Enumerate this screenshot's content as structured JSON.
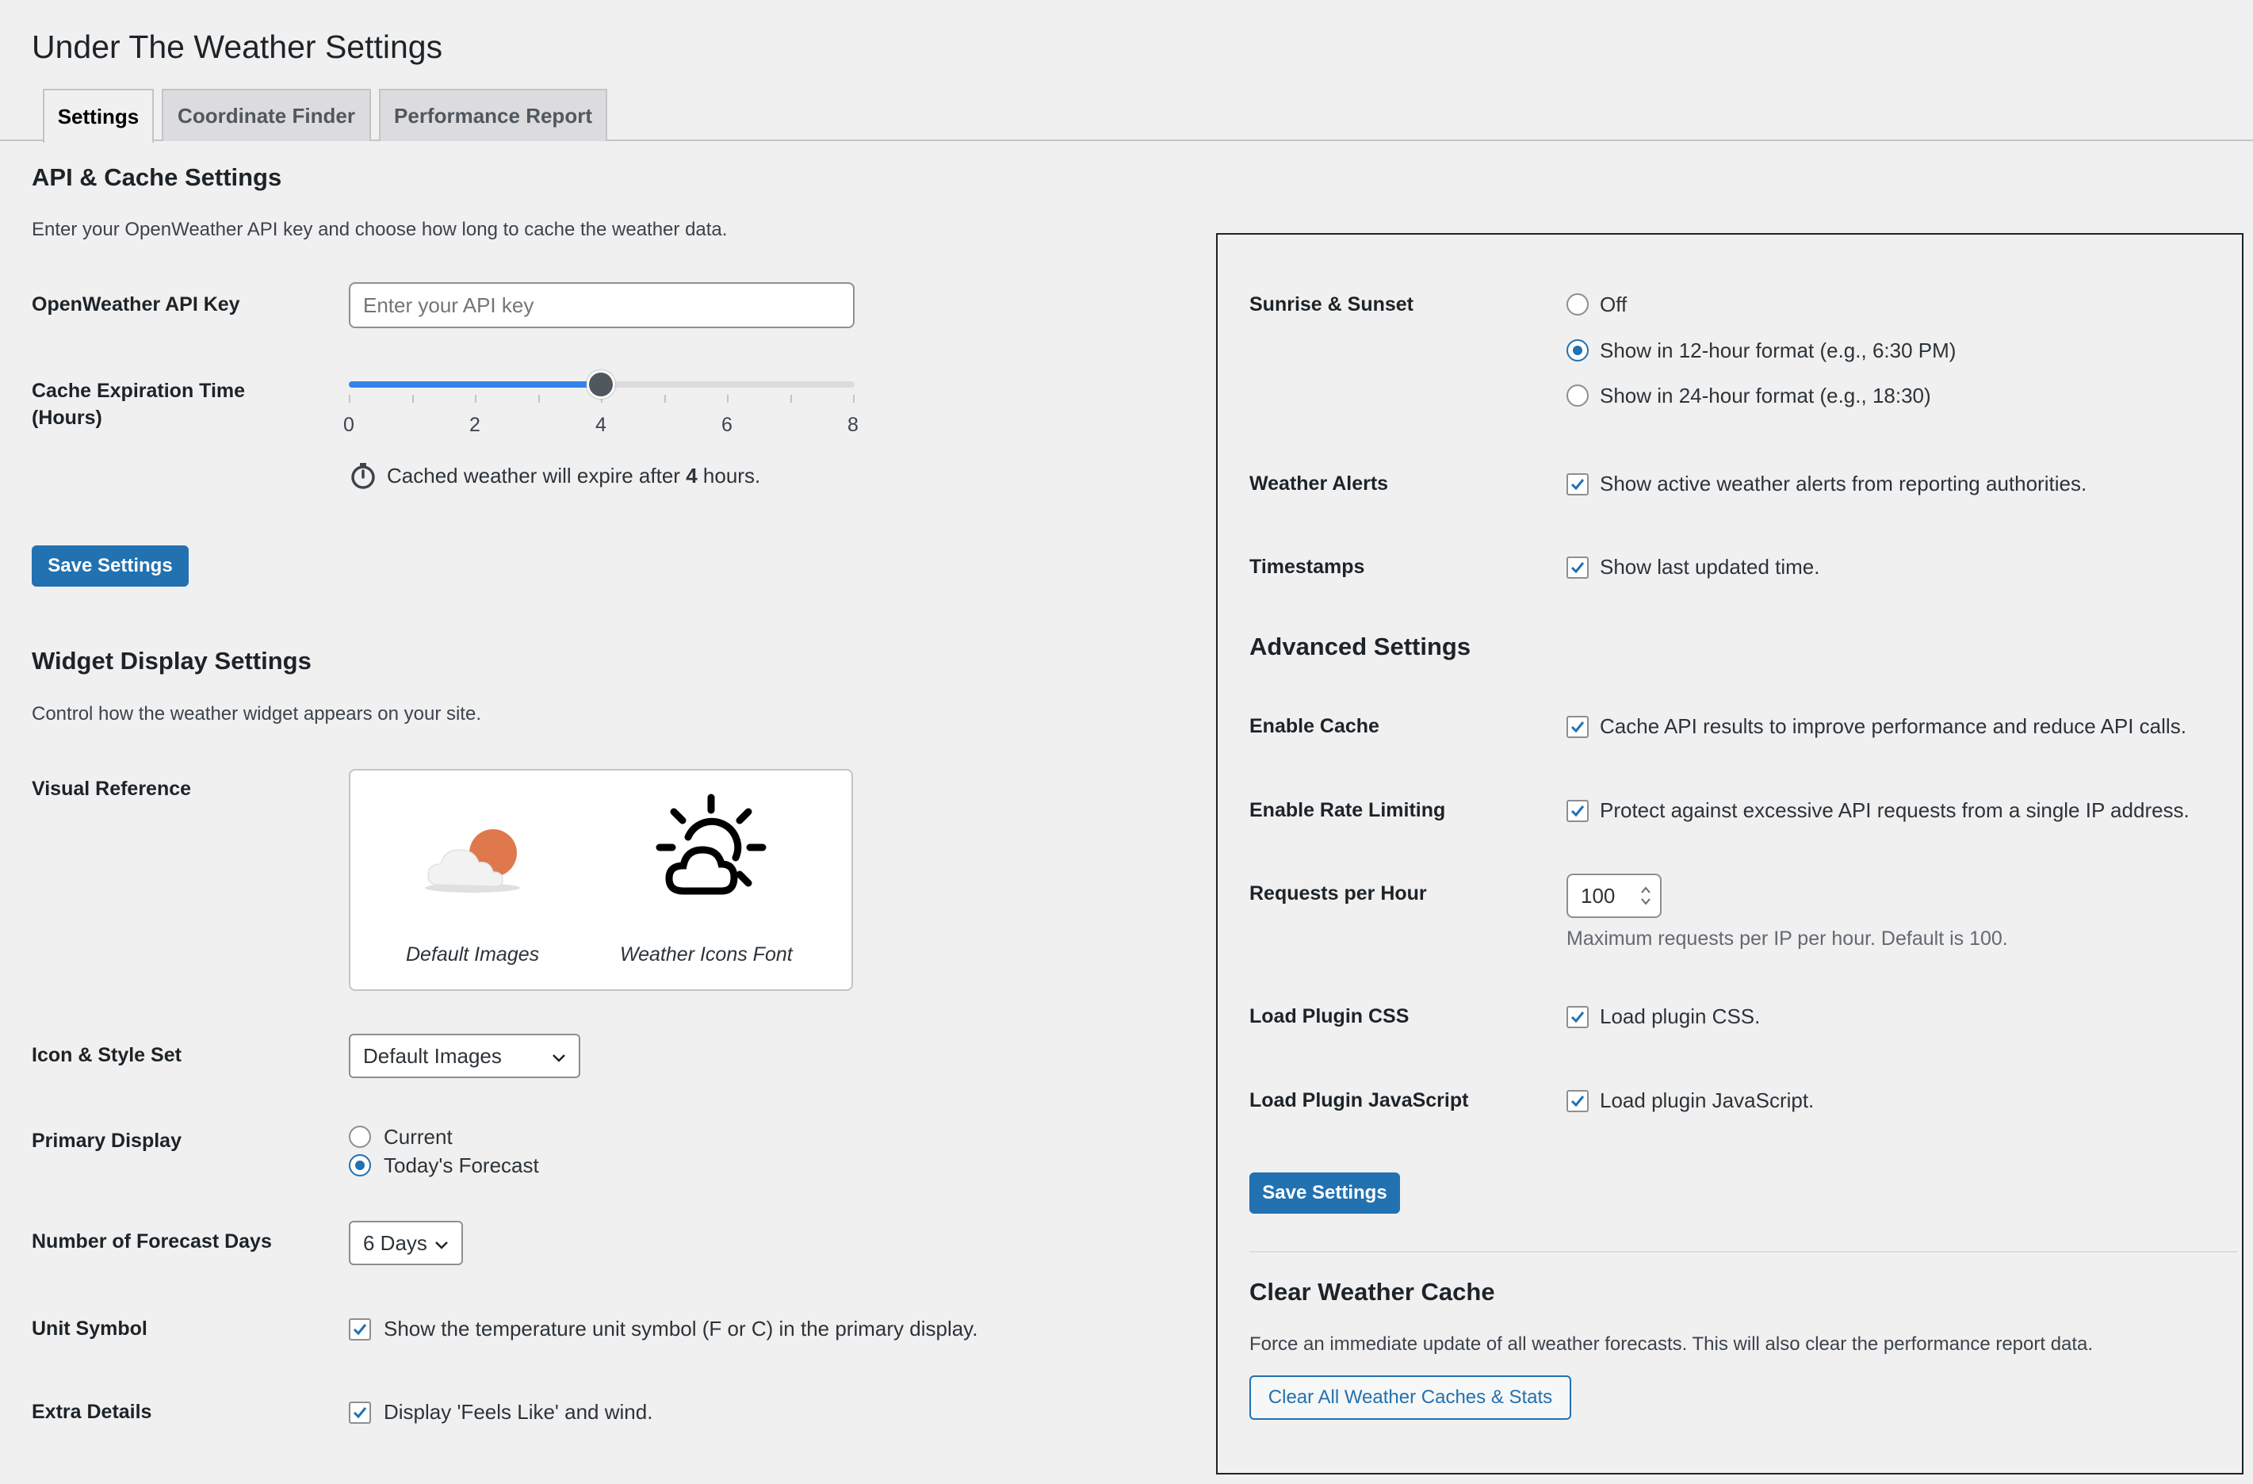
{
  "page": {
    "title": "Under The Weather Settings"
  },
  "tabs": [
    {
      "label": "Settings",
      "active": true
    },
    {
      "label": "Coordinate Finder",
      "active": false
    },
    {
      "label": "Performance Report",
      "active": false
    }
  ],
  "api_cache": {
    "heading": "API & Cache Settings",
    "description": "Enter your OpenWeather API key and choose how long to cache the weather data.",
    "api_key_label": "OpenWeather API Key",
    "api_key_placeholder": "Enter your API key",
    "api_key_value": "",
    "cache_label_line1": "Cache Expiration Time",
    "cache_label_line2": "(Hours)",
    "slider": {
      "min": 0,
      "max": 8,
      "value": 4,
      "ticks": [
        "0",
        "2",
        "4",
        "6",
        "8"
      ]
    },
    "expire_text_before": "Cached weather will expire after",
    "expire_hours": "4",
    "expire_text_after": "hours.",
    "save_label": "Save Settings"
  },
  "widget_display": {
    "heading": "Widget Display Settings",
    "description": "Control how the weather widget appears on your site.",
    "visual_reference_label": "Visual Reference",
    "visual_captions": [
      "Default Images",
      "Weather Icons Font"
    ],
    "icon_set_label": "Icon & Style Set",
    "icon_set_value": "Default Images",
    "primary_display_label": "Primary Display",
    "primary_display_options": [
      {
        "label": "Current",
        "checked": false
      },
      {
        "label": "Today's Forecast",
        "checked": true
      }
    ],
    "forecast_days_label": "Number of Forecast Days",
    "forecast_days_value": "6 Days",
    "unit_symbol_label": "Unit Symbol",
    "unit_symbol_text": "Show the temperature unit symbol (F or C) in the primary display.",
    "extra_details_label": "Extra Details",
    "extra_details_text": "Display 'Feels Like' and wind."
  },
  "right": {
    "sunrise_label": "Sunrise & Sunset",
    "sunrise_options": [
      {
        "label": "Off",
        "checked": false
      },
      {
        "label": "Show in 12-hour format (e.g., 6:30 PM)",
        "checked": true
      },
      {
        "label": "Show in 24-hour format (e.g., 18:30)",
        "checked": false
      }
    ],
    "alerts_label": "Weather Alerts",
    "alerts_text": "Show active weather alerts from reporting authorities.",
    "timestamps_label": "Timestamps",
    "timestamps_text": "Show last updated time.",
    "advanced_heading": "Advanced Settings",
    "enable_cache_label": "Enable Cache",
    "enable_cache_text": "Cache API results to improve performance and reduce API calls.",
    "rate_limit_label": "Enable Rate Limiting",
    "rate_limit_text": "Protect against excessive API requests from a single IP address.",
    "requests_label": "Requests per Hour",
    "requests_value": "100",
    "requests_help": "Maximum requests per IP per hour. Default is 100.",
    "load_css_label": "Load Plugin CSS",
    "load_css_text": "Load plugin CSS.",
    "load_js_label": "Load Plugin JavaScript",
    "load_js_text": "Load plugin JavaScript.",
    "save_label": "Save Settings",
    "clear_heading": "Clear Weather Cache",
    "clear_description": "Force an immediate update of all weather forecasts. This will also clear the performance report data.",
    "clear_button": "Clear All Weather Caches & Stats"
  },
  "colors": {
    "accent": "#2271b1",
    "slider_fill": "#3582e8",
    "sun": "#e0784e"
  }
}
